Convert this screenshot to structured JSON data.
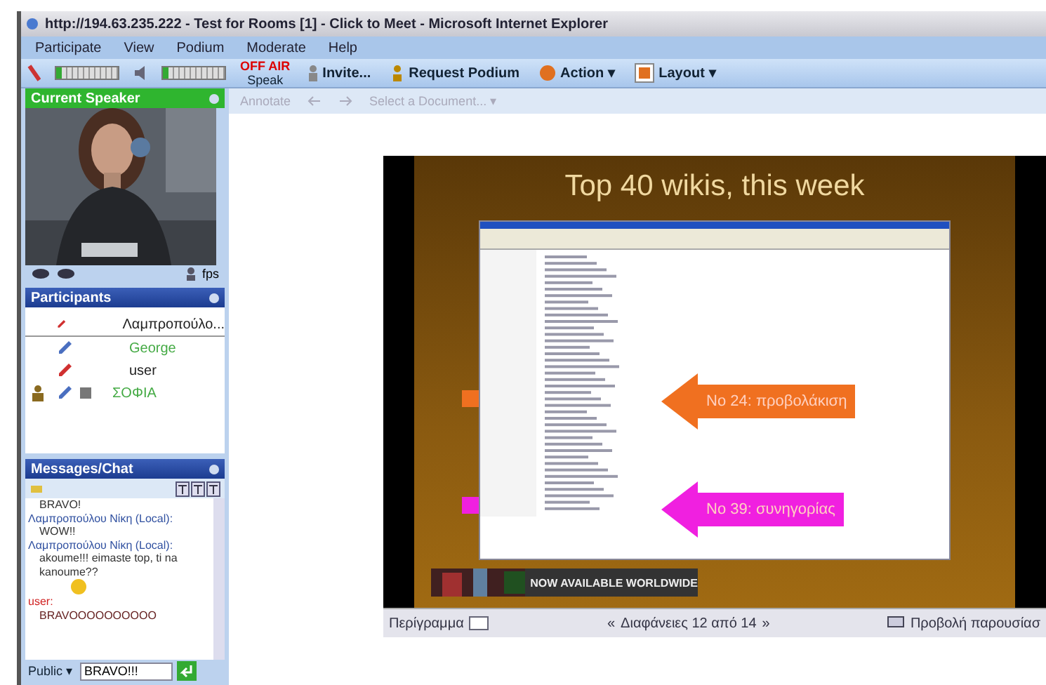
{
  "window": {
    "title": "http://194.63.235.222 - Test for Rooms [1] - Click to Meet - Microsoft Internet Explorer"
  },
  "menu": [
    "Participate",
    "View",
    "Podium",
    "Moderate",
    "Help"
  ],
  "toolbar": {
    "mic": {
      "level": 0.1
    },
    "speaker": {
      "level": 0.1
    },
    "status": "OFF AIR",
    "speak": "Speak",
    "invite": "Invite...",
    "podium": "Request Podium",
    "action": "Action",
    "layout": "Layout",
    "caret": "▾"
  },
  "speaker_panel": {
    "title": "Current Speaker",
    "fps": "fps"
  },
  "participants": {
    "title": "Participants",
    "items": [
      {
        "name": "Λαμπροπούλο...",
        "color": "#d03030",
        "highlighted": false,
        "moderator": false
      },
      {
        "name": "George",
        "color": "#4a6fc0",
        "highlighted": true,
        "moderator": false
      },
      {
        "name": "user",
        "color": "#d03030",
        "highlighted": false,
        "moderator": false
      },
      {
        "name": "ΣΟΦΙΑ",
        "color": "#4a6fc0",
        "highlighted": true,
        "moderator": true
      }
    ]
  },
  "chat": {
    "title": "Messages/Chat",
    "messages": [
      {
        "kind": "text",
        "text": "BRAVO!",
        "local": true
      },
      {
        "kind": "text",
        "author": "Λαμπροπούλου Νίκη (Local):",
        "text": "WOW!!",
        "local": true
      },
      {
        "kind": "text",
        "author": "Λαμπροπούλου Νίκη (Local):",
        "text": "akoume!!! eimaste top, ti na kanoume??",
        "local": true
      },
      {
        "kind": "smiley"
      },
      {
        "kind": "text",
        "author": "user:",
        "text": "BRAVOOOOOOOOOO",
        "local": false
      }
    ],
    "audience": "Public",
    "caret": "▾",
    "draft": "BRAVO!!!"
  },
  "document_bar": {
    "annotate": "Annotate",
    "select": "Select a Document...",
    "caret": "▾",
    "disabled": true
  },
  "slide": {
    "title": "Top 40 wikis, this week",
    "callouts": [
      {
        "text": "No 24: προβολάκιση",
        "color": "#f07020"
      },
      {
        "text": "No 39: συνηγορίας",
        "color": "#f020e0"
      }
    ],
    "banner": "NOW AVAILABLE WORLDWIDE"
  },
  "slide_bar": {
    "outline": "Περίγραμμα",
    "prev": "«",
    "position": "Διαφάνειες 12 από 14",
    "next": "»",
    "slideshow": "Προβολή παρουσίασ"
  }
}
